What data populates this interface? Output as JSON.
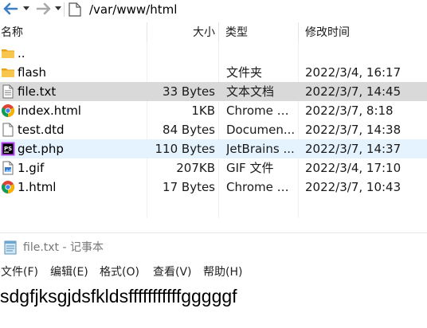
{
  "address_bar": {
    "path": "/var/www/html",
    "back_icon": "arrow-left-icon",
    "forward_icon": "arrow-right-icon"
  },
  "file_list": {
    "columns": {
      "name": "名称",
      "size": "大小",
      "type": "类型",
      "modified": "修改时间"
    },
    "rows": [
      {
        "icon": "folder-icon",
        "name": "..",
        "size": "",
        "type": "",
        "modified": ""
      },
      {
        "icon": "folder-icon",
        "name": "flash",
        "size": "",
        "type": "文件夹",
        "modified": "2022/3/4, 16:17"
      },
      {
        "icon": "text-file-icon",
        "name": "file.txt",
        "size": "33 Bytes",
        "type": "文本文档",
        "modified": "2022/3/7, 14:45",
        "state": "selected"
      },
      {
        "icon": "chrome-icon",
        "name": "index.html",
        "size": "1KB",
        "type": "Chrome H...",
        "modified": "2022/3/7, 8:18"
      },
      {
        "icon": "document-icon",
        "name": "test.dtd",
        "size": "84 Bytes",
        "type": "Documen...",
        "modified": "2022/3/7, 14:38"
      },
      {
        "icon": "phpstorm-icon",
        "name": "get.php",
        "size": "110 Bytes",
        "type": "JetBrains ...",
        "modified": "2022/3/7, 14:37",
        "state": "hover"
      },
      {
        "icon": "image-file-icon",
        "name": "1.gif",
        "size": "207KB",
        "type": "GIF 文件",
        "modified": "2022/3/4, 17:10"
      },
      {
        "icon": "chrome-icon",
        "name": "1.html",
        "size": "17 Bytes",
        "type": "Chrome H...",
        "modified": "2022/3/7, 10:43"
      }
    ]
  },
  "notepad": {
    "title": "file.txt - 记事本",
    "icon": "notepad-icon",
    "menu": [
      "文件(F)",
      "编辑(E)",
      "格式(O)",
      "查看(V)",
      "帮助(H)"
    ],
    "content": "sdgfjksgjdsfkldsfffffffffffgggggf"
  },
  "colors": {
    "selected_row": "#d9d9d9",
    "hover_row": "#e5f3ff",
    "nav_arrow": "#3c7fc4",
    "folder": "#f4c04e"
  }
}
